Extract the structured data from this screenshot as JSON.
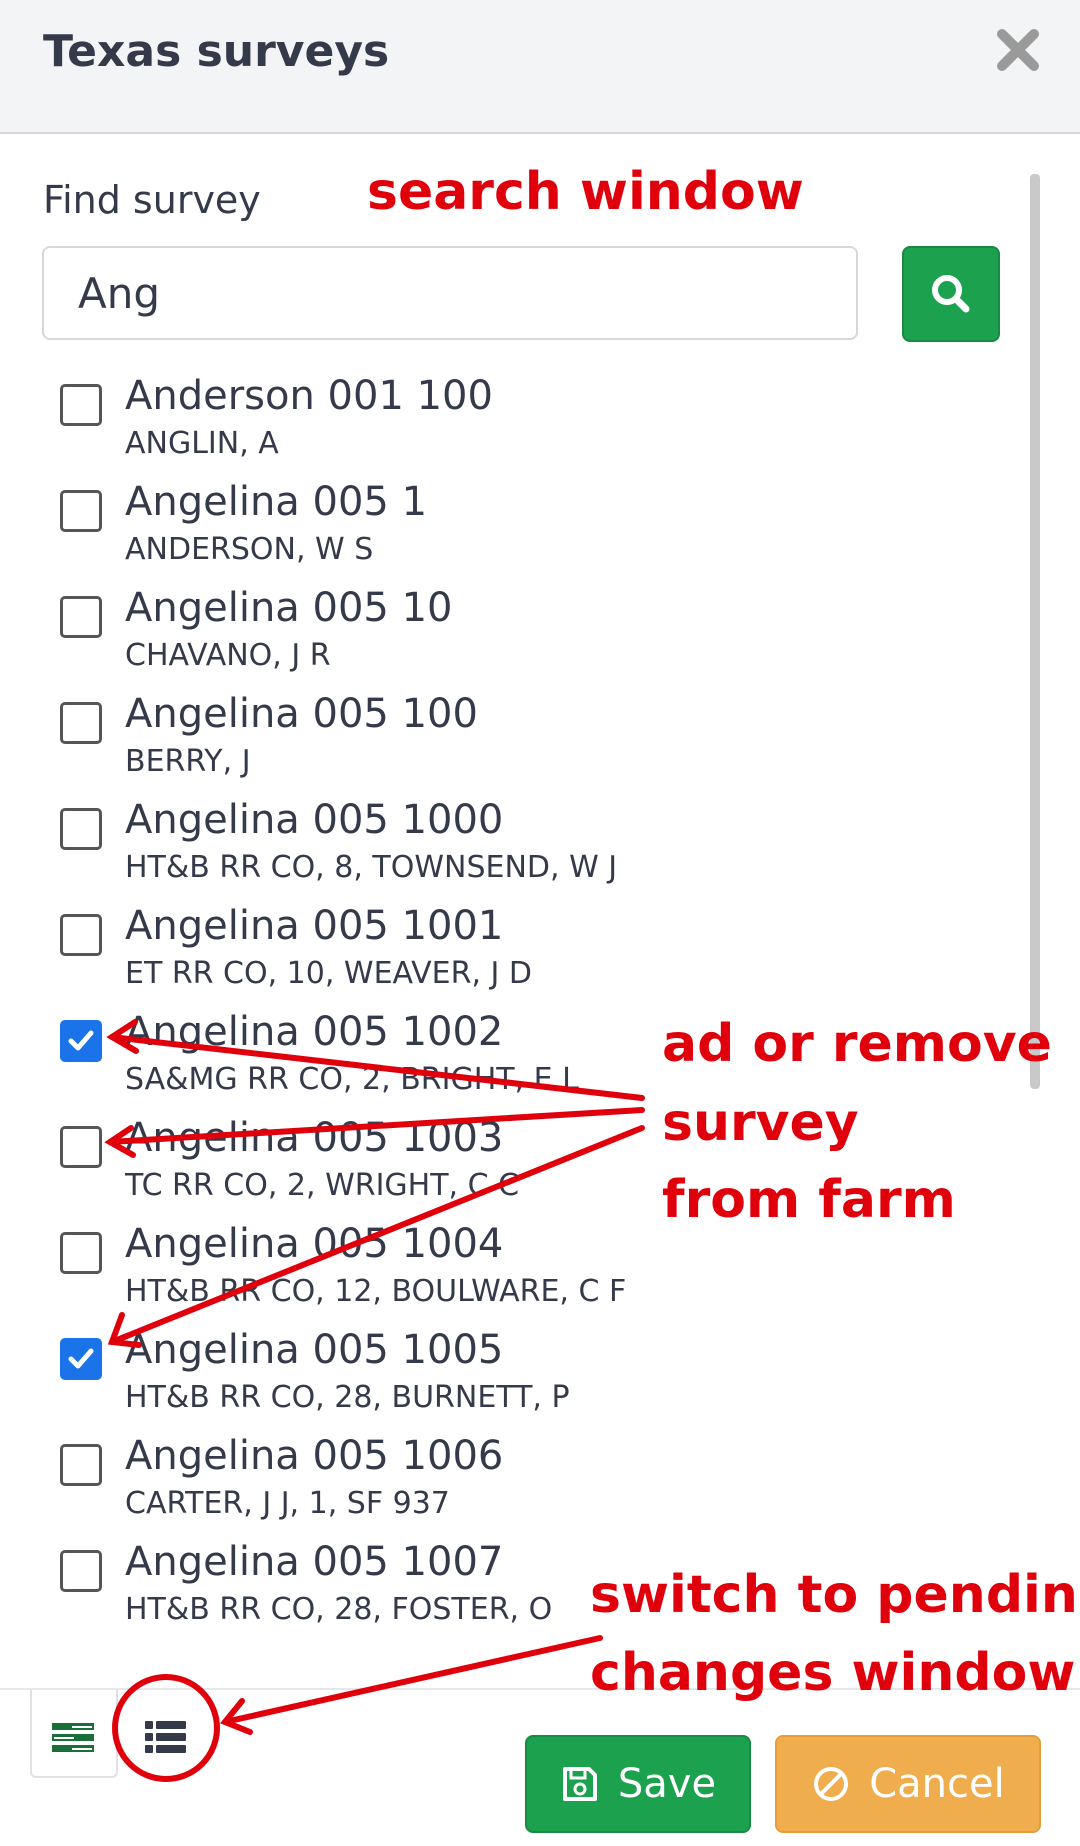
{
  "dialog": {
    "title": "Texas surveys"
  },
  "search": {
    "label": "Find survey",
    "value": "Ang"
  },
  "items": [
    {
      "title": "Anderson 001 100",
      "subtitle": "ANGLIN, A",
      "checked": false
    },
    {
      "title": "Angelina 005 1",
      "subtitle": "ANDERSON, W S",
      "checked": false
    },
    {
      "title": "Angelina 005 10",
      "subtitle": "CHAVANO, J R",
      "checked": false
    },
    {
      "title": "Angelina 005 100",
      "subtitle": "BERRY, J",
      "checked": false
    },
    {
      "title": "Angelina 005 1000",
      "subtitle": "HT&B RR CO, 8, TOWNSEND, W J",
      "checked": false
    },
    {
      "title": "Angelina 005 1001",
      "subtitle": "ET RR CO, 10, WEAVER, J D",
      "checked": false
    },
    {
      "title": "Angelina 005 1002",
      "subtitle": "SA&MG RR CO, 2, BRIGHT, E L",
      "checked": true
    },
    {
      "title": "Angelina 005 1003",
      "subtitle": "TC RR CO, 2, WRIGHT, C C",
      "checked": false
    },
    {
      "title": "Angelina 005 1004",
      "subtitle": "HT&B RR CO, 12, BOULWARE, C F",
      "checked": false
    },
    {
      "title": "Angelina 005 1005",
      "subtitle": "HT&B RR CO, 28, BURNETT, P",
      "checked": true
    },
    {
      "title": "Angelina 005 1006",
      "subtitle": "CARTER, J J, 1, SF 937",
      "checked": false
    },
    {
      "title": "Angelina 005 1007",
      "subtitle": "HT&B RR CO, 28, FOSTER, O",
      "checked": false
    }
  ],
  "footer": {
    "save_label": "Save",
    "cancel_label": "Cancel"
  },
  "annotations": {
    "search_window": "search window",
    "add_remove_line1": "ad or remove",
    "add_remove_line2": "survey",
    "add_remove_line3": "from farm",
    "switch_line1": "switch to pending",
    "switch_line2": "changes window"
  },
  "colors": {
    "accent_green": "#1ca14f",
    "cancel_orange": "#f0ad4e",
    "checkbox_blue": "#1a73e8",
    "annotation_red": "#e0000c",
    "text": "#343a4a"
  }
}
